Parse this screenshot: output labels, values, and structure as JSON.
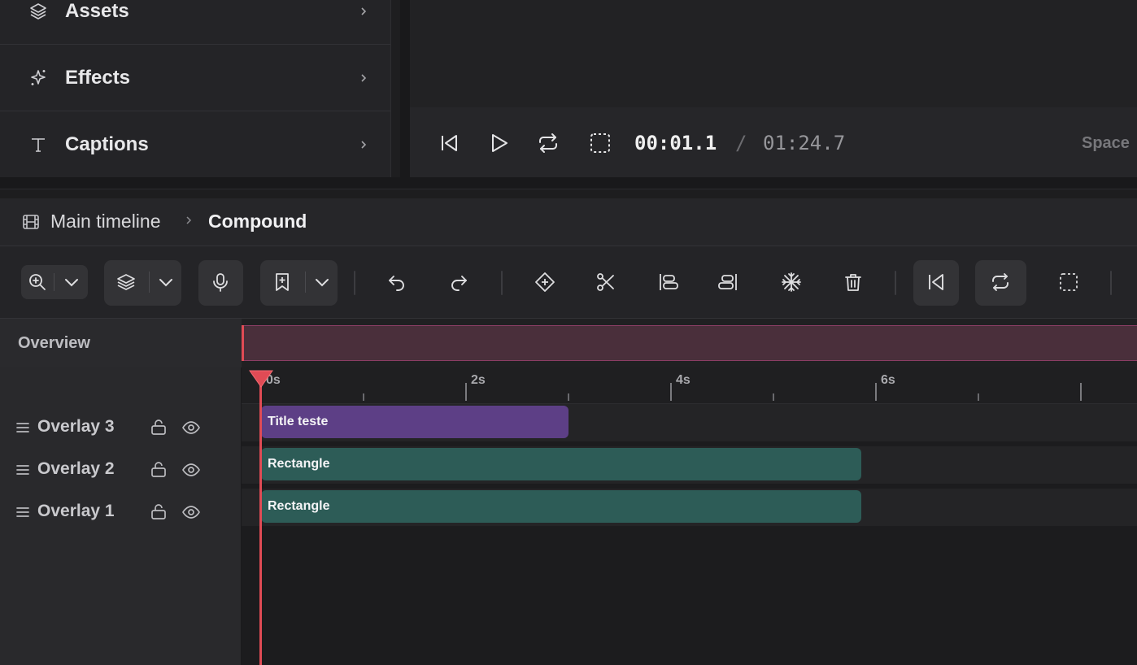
{
  "side_panel": {
    "items": [
      {
        "label": "Assets",
        "icon": "layers-icon"
      },
      {
        "label": "Effects",
        "icon": "sparkles-icon"
      },
      {
        "label": "Captions",
        "icon": "text-icon"
      }
    ]
  },
  "transport": {
    "current_time": "00:01.1",
    "separator": "/",
    "total_time": "01:24.7",
    "shortcut_hint": "Space"
  },
  "breadcrumb": {
    "root": "Main timeline",
    "current": "Compound"
  },
  "toolbar": {
    "buttons": [
      "zoom-in",
      "layers",
      "microphone",
      "add-marker",
      "undo",
      "redo",
      "keyframe",
      "split",
      "align-left",
      "align-right",
      "freeze",
      "delete",
      "skip-to-start",
      "loop",
      "selection"
    ]
  },
  "overview": {
    "label": "Overview",
    "progress": 0.013
  },
  "ruler": {
    "labels": [
      "0s",
      "2s",
      "4s",
      "6s"
    ]
  },
  "tracks": [
    {
      "name": "Overlay 3",
      "clip": "Title teste",
      "clip_start_s": 0,
      "clip_end_s": 3.0,
      "color": "#5d3f86"
    },
    {
      "name": "Overlay 2",
      "clip": "Rectangle",
      "clip_start_s": 0,
      "clip_end_s": 5.85,
      "color": "#2d5c57"
    },
    {
      "name": "Overlay 1",
      "clip": "Rectangle",
      "clip_start_s": 0,
      "clip_end_s": 5.85,
      "color": "#2d5c57"
    }
  ],
  "colors": {
    "playhead": "#e04b55",
    "overview_track": "#4a2f3b",
    "title_clip": "#5d3f86",
    "rect_clip": "#2d5c57"
  }
}
